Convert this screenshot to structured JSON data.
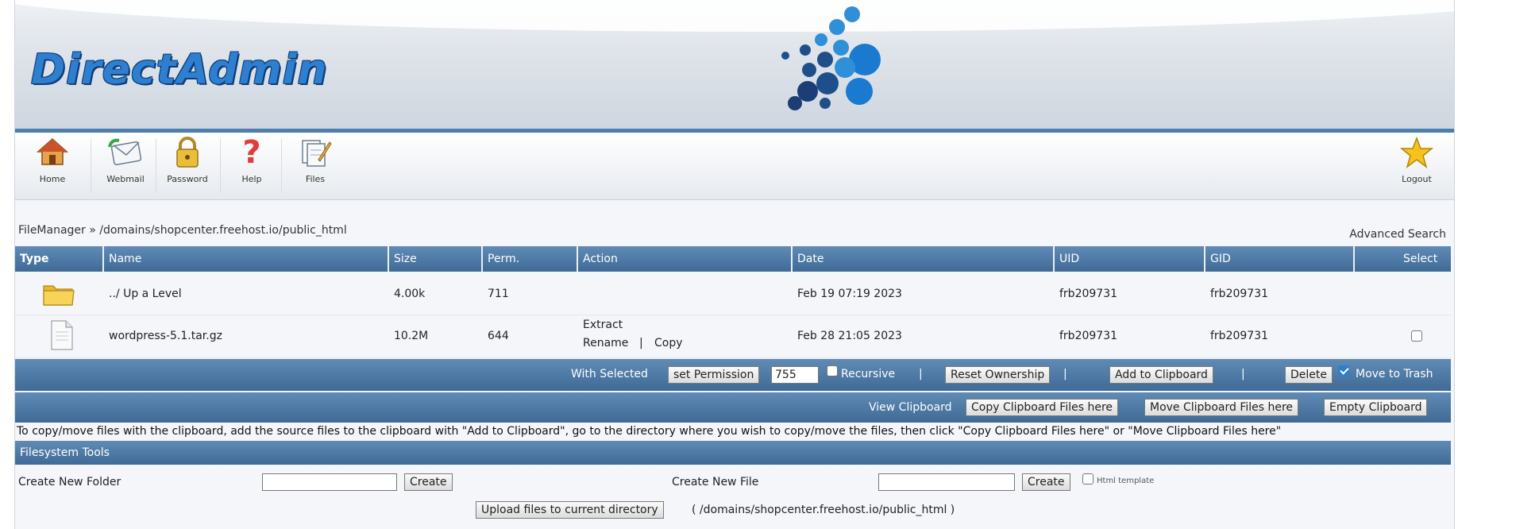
{
  "logo": "DirectAdmin",
  "nav": [
    {
      "label": "Home",
      "icon": "home-icon"
    },
    {
      "label": "Webmail",
      "icon": "webmail-icon"
    },
    {
      "label": "Password",
      "icon": "lock-icon"
    },
    {
      "label": "Help",
      "icon": "help-icon"
    },
    {
      "label": "Files",
      "icon": "files-icon"
    }
  ],
  "logout": {
    "label": "Logout",
    "icon": "star-icon"
  },
  "breadcrumb": "FileManager » /domains/shopcenter.freehost.io/public_html",
  "advanced_search": "Advanced Search",
  "table": {
    "columns": [
      "Type",
      "Name",
      "Size",
      "Perm.",
      "Action",
      "Date",
      "UID",
      "GID",
      "Select"
    ],
    "rows": [
      {
        "type_icon": "folder-icon",
        "name": "../ Up a Level",
        "size": "4.00k",
        "perm": "711",
        "date": "Feb 19 07:19 2023",
        "uid": "frb209731",
        "gid": "frb209731"
      },
      {
        "type_icon": "file-icon",
        "name": "wordpress-5.1.tar.gz",
        "size": "10.2M",
        "perm": "644",
        "action_extract": "Extract",
        "action_rename": "Rename",
        "action_sep": "|",
        "action_copy": "Copy",
        "date": "Feb 28 21:05 2023",
        "uid": "frb209731",
        "gid": "frb209731",
        "selected": false
      }
    ]
  },
  "selected_bar": {
    "with_selected": "With Selected",
    "set_permission": "set Permission",
    "permission_value": "755",
    "recursive": "Recursive",
    "recursive_checked": false,
    "sep": "|",
    "reset_ownership": "Reset Ownership",
    "add_to_clipboard": "Add to Clipboard",
    "delete": "Delete",
    "move_to_trash": "Move to Trash",
    "move_to_trash_checked": true
  },
  "clipboard_bar": {
    "view_clipboard": "View Clipboard",
    "copy_here": "Copy Clipboard Files here",
    "move_here": "Move Clipboard Files here",
    "empty": "Empty Clipboard"
  },
  "clipboard_note": "To copy/move files with the clipboard, add the source files to the clipboard with \"Add to Clipboard\", go to the directory where you wish to copy/move the files, then click \"Copy Clipboard Files here\" or \"Move Clipboard Files here\"",
  "fs_tools": {
    "title": "Filesystem Tools",
    "create_folder_label": "Create New Folder",
    "create_folder_value": "",
    "create_button": "Create",
    "create_file_label": "Create New File",
    "create_file_value": "",
    "html_template": "Html template",
    "upload_button": "Upload files to current directory",
    "upload_path": "( /domains/shopcenter.freehost.io/public_html )"
  },
  "colors": {
    "header_blue": "#4c7fae",
    "bar_blue": "#3f6a96",
    "logo_blue": "#2f7fd1"
  }
}
